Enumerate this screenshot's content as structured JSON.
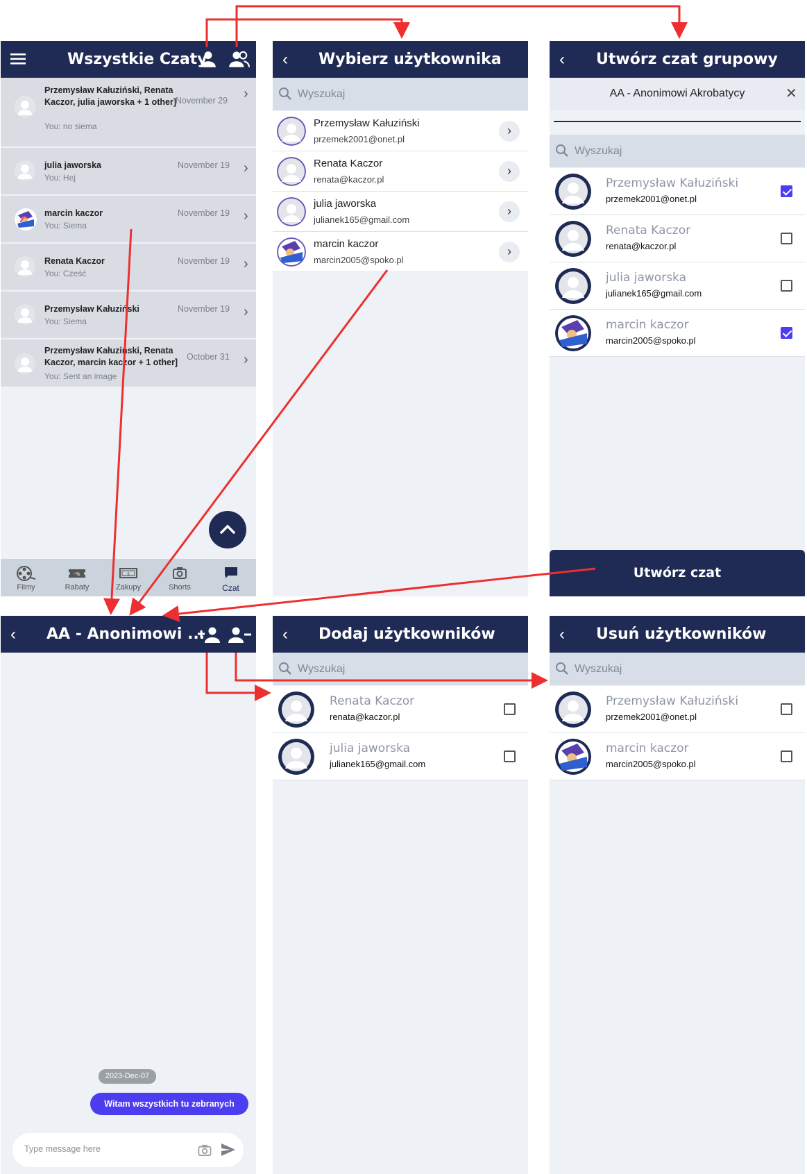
{
  "screen1": {
    "title": "Wszystkie Czaty",
    "chats": [
      {
        "name": "Przemysław Kałuziński, Renata Kaczor, julia jaworska + 1 other]",
        "date": "November 29",
        "preview": "You: no siema",
        "avatar": "default"
      },
      {
        "name": "julia jaworska",
        "date": "November 19",
        "preview": "You: Hej",
        "avatar": "default"
      },
      {
        "name": "marcin kaczor",
        "date": "November 19",
        "preview": "You: Siema",
        "avatar": "custom"
      },
      {
        "name": "Renata Kaczor",
        "date": "November 19",
        "preview": "You: Cześć",
        "avatar": "default"
      },
      {
        "name": "Przemysław Kałuziński",
        "date": "November 19",
        "preview": "You: Siema",
        "avatar": "default"
      },
      {
        "name": "Przemysław Kałuziński, Renata Kaczor, marcin kaczor + 1 other]",
        "date": "October 31",
        "preview": "You: Sent an image",
        "avatar": "default"
      }
    ],
    "nav": [
      {
        "label": "Filmy",
        "icon": "film-reel-icon"
      },
      {
        "label": "Rabaty",
        "icon": "discount-tag-icon"
      },
      {
        "label": "Zakupy",
        "icon": "cash-icon"
      },
      {
        "label": "Shorts",
        "icon": "camera-icon"
      },
      {
        "label": "Czat",
        "icon": "chat-bubble-icon"
      }
    ]
  },
  "screen2": {
    "title": "Wybierz użytkownika",
    "search_placeholder": "Wyszukaj",
    "users": [
      {
        "name": "Przemysław Kałuziński",
        "email": "przemek2001@onet.pl"
      },
      {
        "name": "Renata Kaczor",
        "email": "renata@kaczor.pl"
      },
      {
        "name": "julia jaworska",
        "email": "julianek165@gmail.com"
      },
      {
        "name": "marcin kaczor",
        "email": "marcin2005@spoko.pl"
      }
    ]
  },
  "screen3": {
    "title": "Utwórz czat grupowy",
    "group_name": "AA - Anonimowi Akrobatycy",
    "search_placeholder": "Wyszukaj",
    "users": [
      {
        "name": "Przemysław Kałuziński",
        "email": "przemek2001@onet.pl",
        "checked": true
      },
      {
        "name": "Renata Kaczor",
        "email": "renata@kaczor.pl",
        "checked": false
      },
      {
        "name": "julia jaworska",
        "email": "julianek165@gmail.com",
        "checked": false
      },
      {
        "name": "marcin kaczor",
        "email": "marcin2005@spoko.pl",
        "checked": true
      }
    ],
    "create_button": "Utwórz czat"
  },
  "screen4": {
    "title": "AA - Anonimowi ...",
    "date_chip": "2023-Dec-07",
    "message": "Witam wszystkich tu zebranych",
    "input_placeholder": "Type message here"
  },
  "screen5": {
    "title": "Dodaj użytkowników",
    "search_placeholder": "Wyszukaj",
    "users": [
      {
        "name": "Renata Kaczor",
        "email": "renata@kaczor.pl"
      },
      {
        "name": "julia jaworska",
        "email": "julianek165@gmail.com"
      }
    ]
  },
  "screen6": {
    "title": "Usuń użytkowników",
    "search_placeholder": "Wyszukaj",
    "users": [
      {
        "name": "Przemysław Kałuziński",
        "email": "przemek2001@onet.pl"
      },
      {
        "name": "marcin kaczor",
        "email": "marcin2005@spoko.pl"
      }
    ]
  },
  "colors": {
    "header": "#1f2a55",
    "accent": "#4d3df0",
    "arrow": "#ee2f2f",
    "bg": "#eef1f6"
  }
}
